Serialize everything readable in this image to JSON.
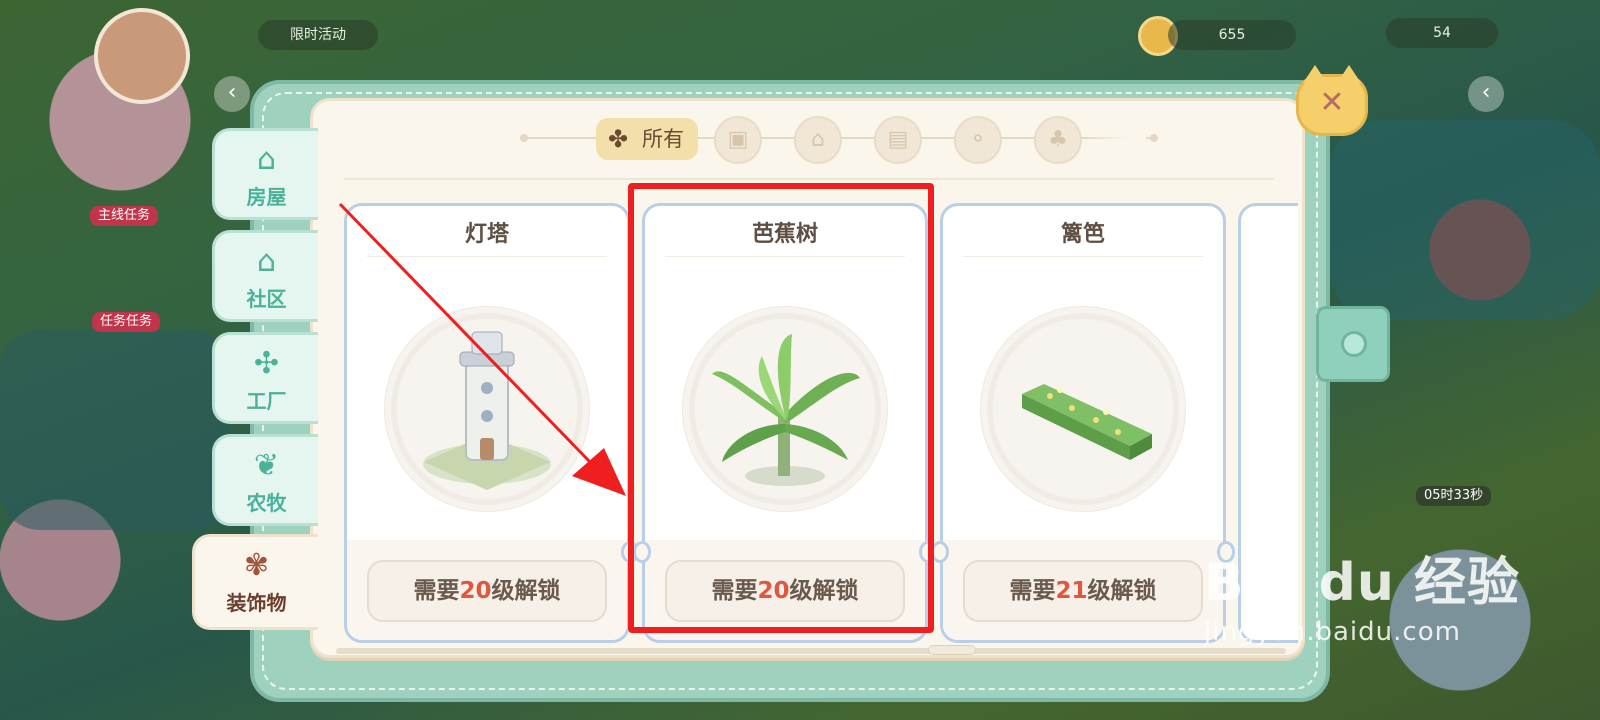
{
  "hud": {
    "left_label": "限时活动",
    "coins": "655",
    "level_pill": "54",
    "bg_labels": [
      "主线任务",
      "任务任务",
      "05时33秒"
    ]
  },
  "sidebar": {
    "tabs": [
      {
        "label": "房屋",
        "icon": "house-icon"
      },
      {
        "label": "社区",
        "icon": "community-icon"
      },
      {
        "label": "工厂",
        "icon": "windmill-icon"
      },
      {
        "label": "农牧",
        "icon": "sprout-icon"
      },
      {
        "label": "装饰物",
        "icon": "decoration-icon",
        "active": true
      }
    ]
  },
  "categories": {
    "active_label": "所有",
    "icons": [
      "chest-icon",
      "house-icon",
      "card-icon",
      "balloon-icon",
      "tree-icon"
    ]
  },
  "items": [
    {
      "name": "灯塔",
      "unlock_prefix": "需要",
      "level": "20",
      "unlock_suffix": "级解锁",
      "art": "lighthouse"
    },
    {
      "name": "芭蕉树",
      "unlock_prefix": "需要",
      "level": "20",
      "unlock_suffix": "级解锁",
      "art": "banana-tree",
      "highlighted": true
    },
    {
      "name": "篱笆",
      "unlock_prefix": "需要",
      "level": "21",
      "unlock_suffix": "级解锁",
      "art": "hedge-fence"
    }
  ],
  "watermark": {
    "brand": "Bai du 经验",
    "url": "jingyan.baidu.com"
  },
  "colors": {
    "accent_mint": "#9fd1bf",
    "level_red": "#e0563f",
    "highlight_red": "#f01f1f",
    "active_category": "#f3dfaa"
  }
}
